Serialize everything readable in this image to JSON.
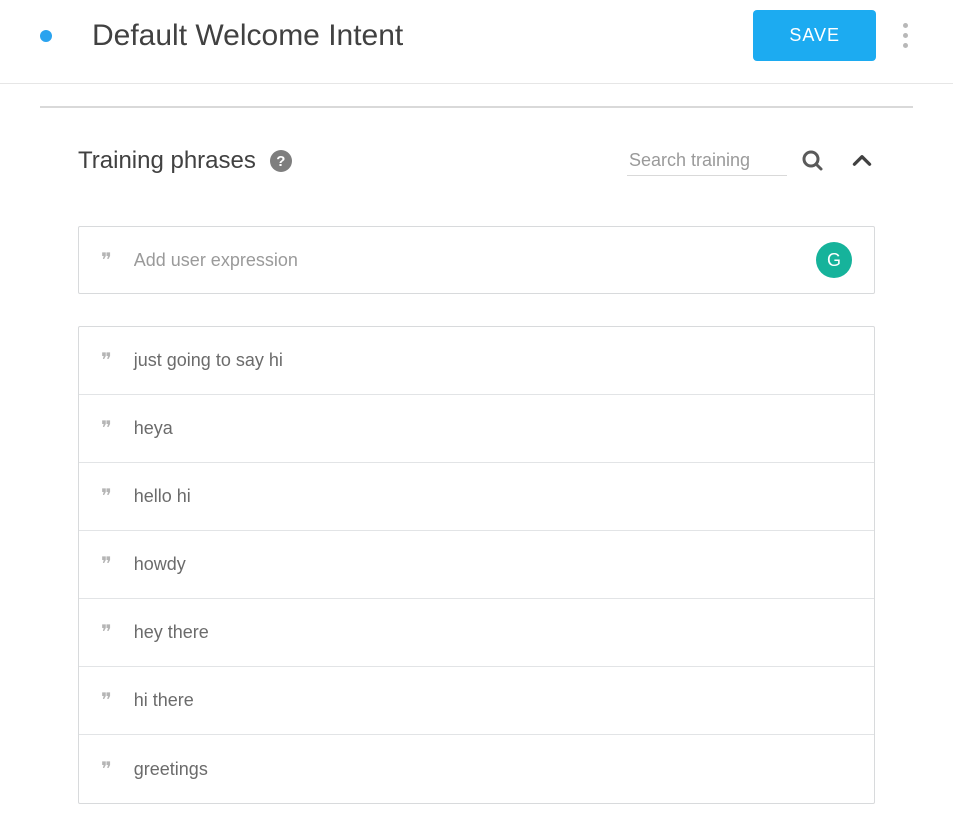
{
  "header": {
    "title": "Default Welcome Intent",
    "save_label": "SAVE"
  },
  "training": {
    "section_title": "Training phrases",
    "search_placeholder": "Search training",
    "add_placeholder": "Add user expression",
    "phrases": [
      "just going to say hi",
      "heya",
      "hello hi",
      "howdy",
      "hey there",
      "hi there",
      "greetings"
    ]
  }
}
